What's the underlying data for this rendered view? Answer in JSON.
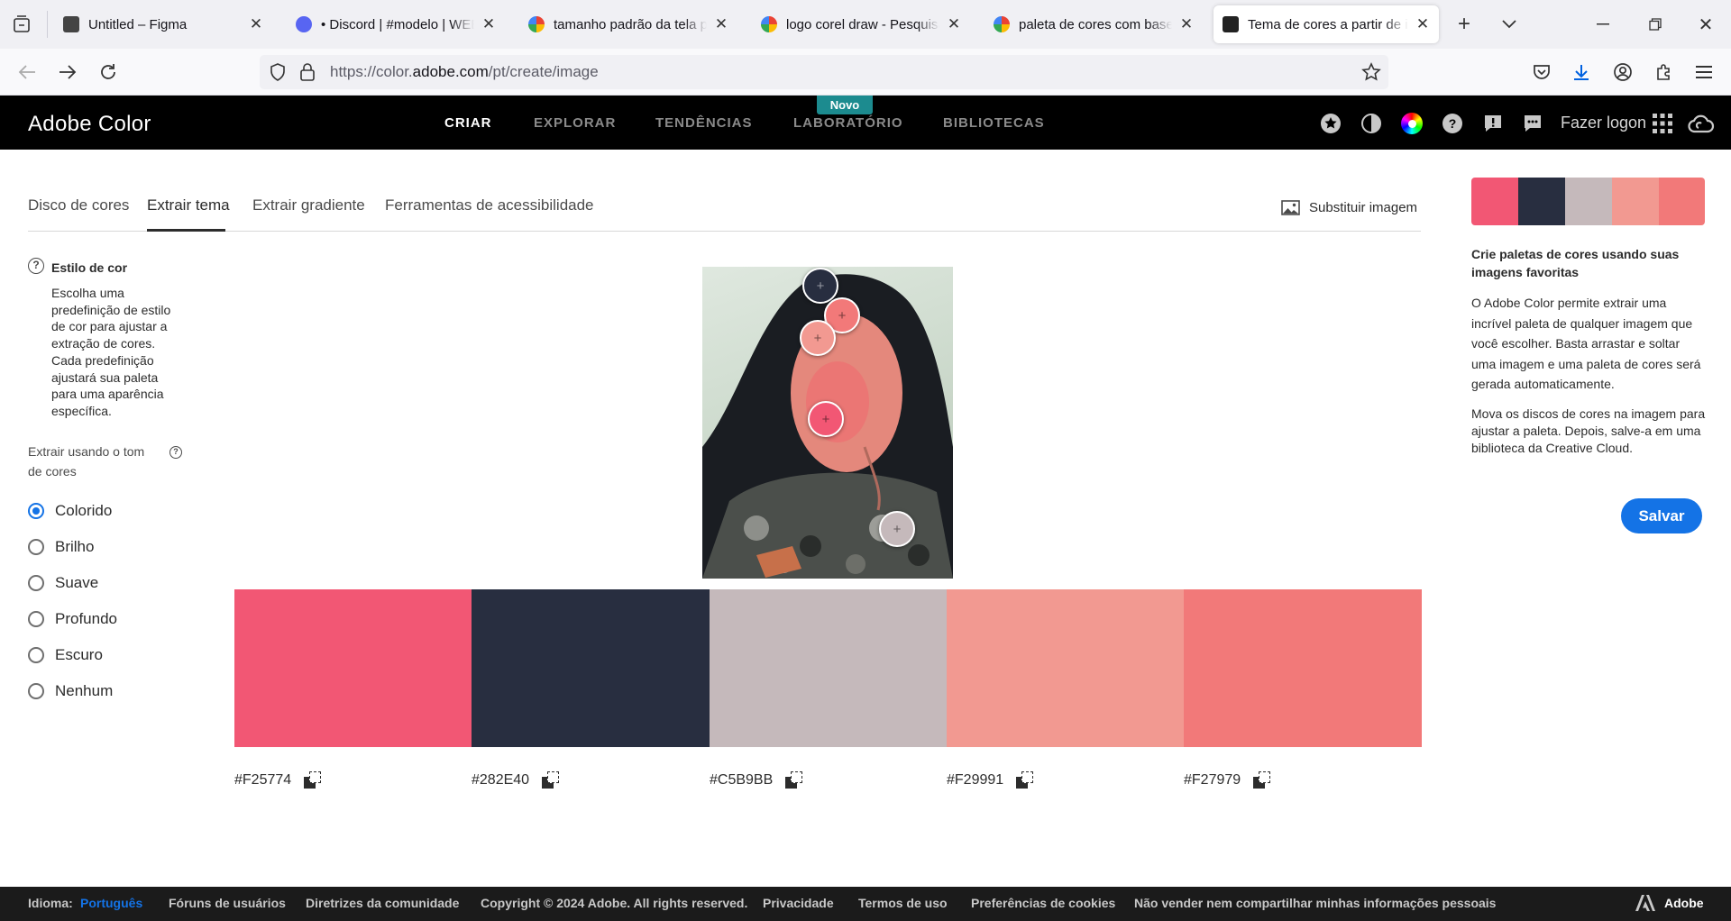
{
  "browser": {
    "tabs": [
      {
        "title": "Untitled – Figma",
        "favicon_color": "#444"
      },
      {
        "title": "• Discord | #modelo | WEB",
        "favicon_color": "#5865f2"
      },
      {
        "title": "tamanho padrão da tela pa",
        "favicon_color": "#4285f4"
      },
      {
        "title": "logo corel draw - Pesquisa",
        "favicon_color": "#4285f4"
      },
      {
        "title": "paleta de cores com base e",
        "favicon_color": "#4285f4"
      },
      {
        "title": "Tema de cores a partir de i",
        "favicon_color": "#222"
      }
    ],
    "url_prefix": "https://color.",
    "url_domain": "adobe.com",
    "url_path": "/pt/create/image"
  },
  "header": {
    "brand": "Adobe Color",
    "nav": [
      "CRIAR",
      "EXPLORAR",
      "TENDÊNCIAS",
      "LABORATÓRIO",
      "BIBLIOTECAS"
    ],
    "new_badge": "Novo",
    "login": "Fazer logon"
  },
  "subtabs": [
    "Disco de cores",
    "Extrair tema",
    "Extrair gradiente",
    "Ferramentas de acessibilidade"
  ],
  "replace_image": "Substituir imagem",
  "left": {
    "style_title": "Estilo de cor",
    "style_desc": "Escolha uma predefinição de estilo de cor para ajustar a extração de cores. Cada predefinição ajustará sua paleta para uma aparência específica.",
    "extract_label": "Extrair usando o tom de cores",
    "options": [
      "Colorido",
      "Brilho",
      "Suave",
      "Profundo",
      "Escuro",
      "Nenhum"
    ],
    "selected": "Colorido"
  },
  "palette": [
    {
      "hex": "#F25774",
      "color": "#F25774"
    },
    {
      "hex": "#282E40",
      "color": "#282E40"
    },
    {
      "hex": "#C5B9BB",
      "color": "#C5B9BB"
    },
    {
      "hex": "#F29991",
      "color": "#F29991"
    },
    {
      "hex": "#F27979",
      "color": "#F27979"
    }
  ],
  "right": {
    "title": "Crie paletas de cores usando suas imagens favoritas",
    "p1": "O Adobe Color permite extrair uma incrível paleta de qualquer imagem que você escolher. Basta arrastar e soltar uma imagem e uma paleta de cores será gerada automaticamente.",
    "p2": "Mova os discos de cores na imagem para ajustar a paleta. Depois, salve-a em uma biblioteca da Creative Cloud.",
    "save": "Salvar"
  },
  "footer": {
    "lang_label": "Idioma:",
    "lang": "Português",
    "links": [
      "Fóruns de usuários",
      "Diretrizes da comunidade",
      "Copyright © 2024 Adobe. All rights reserved.",
      "Privacidade",
      "Termos de uso",
      "Preferências de cookies",
      "Não vender nem compartilhar minhas informações pessoais"
    ],
    "adobe": "Adobe"
  }
}
